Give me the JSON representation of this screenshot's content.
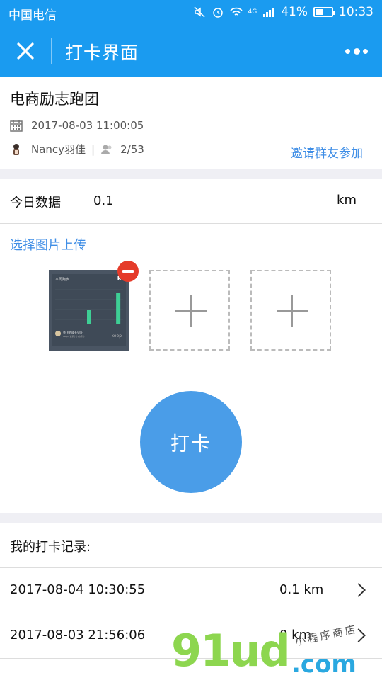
{
  "status_bar": {
    "carrier": "中国电信",
    "network": "4G",
    "battery": "41%",
    "time": "10:33"
  },
  "nav": {
    "title": "打卡界面",
    "close_icon": "close-icon",
    "more_icon": "more-icon"
  },
  "group": {
    "name": "电商励志跑团",
    "datetime": "2017-08-03 11:00:05",
    "user": "Nancy羽佳",
    "separator": "|",
    "members": "2/53",
    "invite_label": "邀请群友参加"
  },
  "today": {
    "label": "今日数据",
    "value": "0.1",
    "unit": "km"
  },
  "upload": {
    "choose_label": "选择图片上传",
    "thumbnail": {
      "header": "本周跑步",
      "logo": "K",
      "caption": "坐飞的成长见证",
      "subcaption": "Keep, 记录小小的成功",
      "brand": "keep",
      "bar_fills": [
        0.0,
        0.0,
        0.0,
        0.42,
        0.0,
        0.0,
        0.95
      ]
    }
  },
  "checkin_button": "打卡",
  "records": {
    "title": "我的打卡记录:",
    "items": [
      {
        "time": "2017-08-04 10:30:55",
        "distance": "0.1 km"
      },
      {
        "time": "2017-08-03 21:56:06",
        "distance": "0 km"
      }
    ]
  },
  "watermark": {
    "text": "91ud",
    "suffix": ".com",
    "tagline": "小程序商店"
  },
  "colors": {
    "primary": "#1a9bf0",
    "button": "#4a9de8",
    "link": "#3f8ee6",
    "danger": "#e53b2a"
  }
}
